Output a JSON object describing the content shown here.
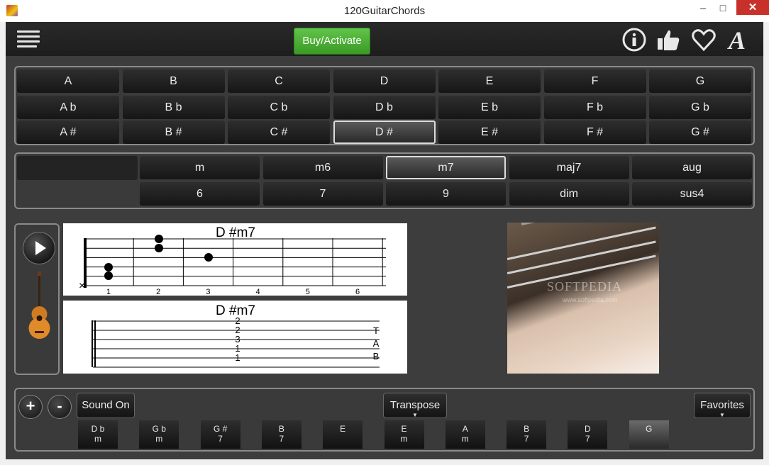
{
  "window": {
    "title": "120GuitarChords",
    "minimize": "–",
    "maximize": "□",
    "close": "✕"
  },
  "toolbar": {
    "buy_label": "Buy/Activate",
    "icons": [
      "menu-icon",
      "info-icon",
      "thumbs-up-icon",
      "heart-icon",
      "font-icon"
    ]
  },
  "keys": {
    "rows": [
      [
        "A",
        "B",
        "C",
        "D",
        "E",
        "F",
        "G"
      ],
      [
        "A b",
        "B b",
        "C b",
        "D b",
        "E b",
        "F b",
        "G b"
      ],
      [
        "A #",
        "B #",
        "C #",
        "D #",
        "E #",
        "F #",
        "G #"
      ]
    ],
    "selected": "D #"
  },
  "types": {
    "row1": [
      "m",
      "m6",
      "m7",
      "maj7",
      "aug"
    ],
    "row2": [
      "6",
      "7",
      "9",
      "dim",
      "sus4"
    ],
    "selected": "m7"
  },
  "chord_diagram": {
    "title": "D #m7",
    "fret_numbers": [
      "1",
      "2",
      "3",
      "4",
      "5",
      "6"
    ],
    "mute_marker": "×"
  },
  "tab": {
    "title": "D #m7",
    "numbers": [
      "2",
      "2",
      "3",
      "1",
      "1"
    ],
    "tab_letters": [
      "T",
      "A",
      "B"
    ]
  },
  "photo": {
    "watermark": "SOFTPEDIA",
    "watermark_url": "www.softpedia.com"
  },
  "bottom": {
    "plus": "+",
    "minus": "-",
    "sound_label": "Sound On",
    "transpose_label": "Transpose",
    "favorites_label": "Favorites",
    "history": [
      [
        "D b",
        "m"
      ],
      [
        "G b",
        "m"
      ],
      [
        "G #",
        "7"
      ],
      [
        "B",
        "7"
      ],
      [
        "E",
        ""
      ],
      [
        "E",
        "m"
      ],
      [
        "A",
        "m"
      ],
      [
        "B",
        "7"
      ],
      [
        "D",
        "7"
      ],
      [
        "G",
        ""
      ]
    ]
  },
  "colors": {
    "background": "#3d3d3d",
    "accent_green": "#4cb034",
    "selected_border": "#dcdcdc"
  }
}
